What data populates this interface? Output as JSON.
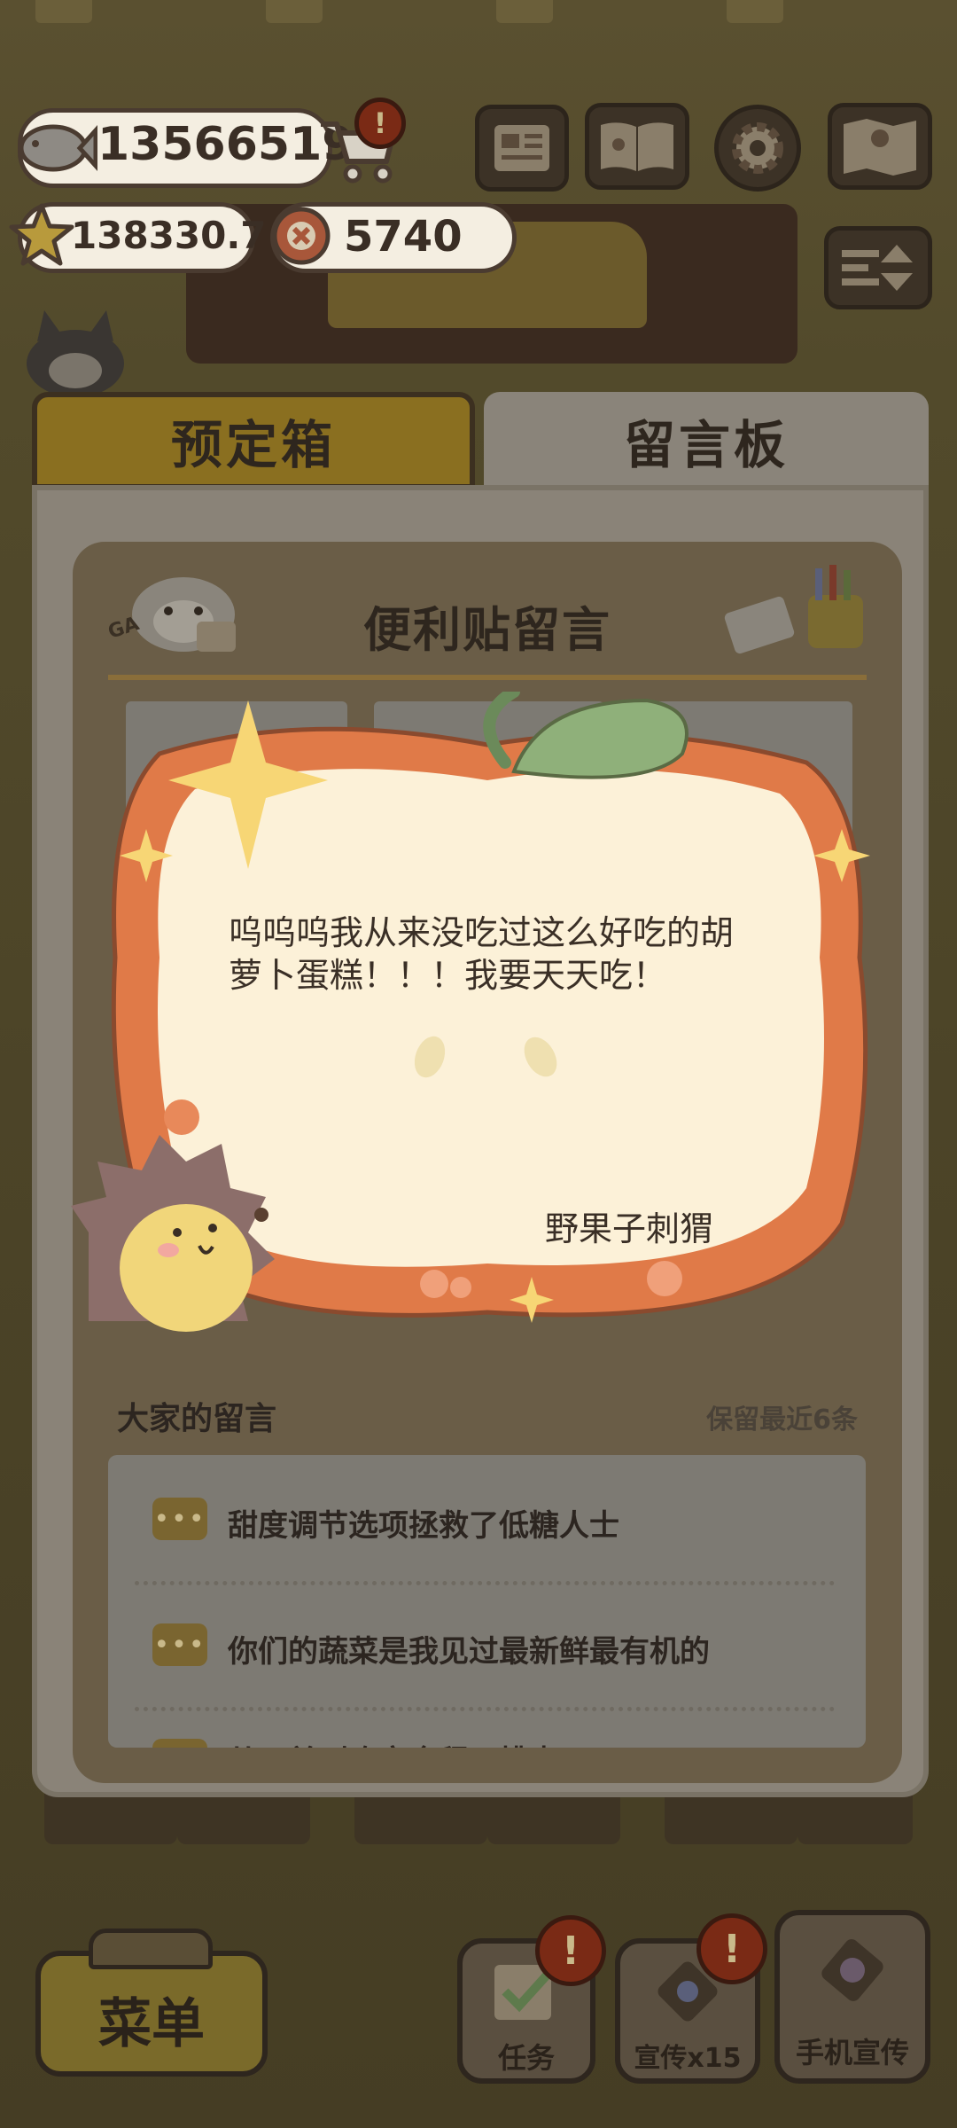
{
  "hud": {
    "fish_count": "13566519",
    "star_count": "138330.7",
    "coin_count": "5740",
    "cart_alert": "!"
  },
  "tabs": [
    {
      "label": "预定箱",
      "active": false
    },
    {
      "label": "留言板",
      "active": true
    }
  ],
  "board": {
    "title": "便利贴留言",
    "ga_tag": "GA",
    "section_title": "大家的留言",
    "section_note": "保留最近6条",
    "messages": [
      "甜度调节选项拯救了低糖人士",
      "你们的蔬菜是我见过最新鲜最有机的",
      "从下单到吃完全程无槽点"
    ],
    "chat_icon_glyph": "•••"
  },
  "featured_note": {
    "text": "呜呜呜我从来没吃过这么好吃的胡萝卜蛋糕！！！我要天天吃！",
    "author": "野果子刺猬"
  },
  "bottom": {
    "menu_label": "菜单",
    "task_label": "任务",
    "promote_label": "宣传x15",
    "phone_promote_label": "手机宣传",
    "alert_glyph": "!"
  },
  "colors": {
    "dim_overlay": "#4a4128",
    "tab_active": "#8a847a",
    "tab_inactive": "#8a6f20",
    "note_orange": "#e07a48",
    "note_cream": "#fcf1d8",
    "leaf_green": "#8fb07a",
    "sparkle_yellow": "#f7d675"
  }
}
